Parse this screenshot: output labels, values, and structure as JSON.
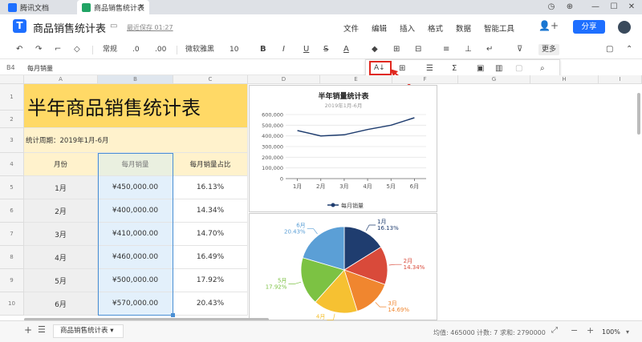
{
  "tabs": [
    {
      "label": "腾讯文档",
      "icon": "tencent-docs-icon"
    },
    {
      "label": "商品销售统计表",
      "icon": "sheet-icon"
    }
  ],
  "header": {
    "title": "商品销售统计表",
    "save_status": "最近保存 01:27",
    "menus": [
      "文件",
      "编辑",
      "插入",
      "格式",
      "数据",
      "智能工具"
    ],
    "share_label": "分享"
  },
  "toolbar": {
    "number_format": "常规",
    "decimal_decrease": ".0",
    "decimal_increase": ".00",
    "font": "微软雅黑",
    "font_size": "10",
    "bold": "B",
    "italic": "I",
    "underline": "U",
    "strike": "S",
    "text_color": "A",
    "more_label": "更多"
  },
  "formula_bar": {
    "cell_ref": "B4",
    "content": "每月销量"
  },
  "columns": [
    "A",
    "B",
    "C",
    "D",
    "E",
    "F",
    "G",
    "H",
    "I"
  ],
  "rows": [
    "1",
    "2",
    "3",
    "4",
    "5",
    "6",
    "7",
    "8",
    "9",
    "10"
  ],
  "sheet": {
    "title": "半年商品销售统计表",
    "period": "统计周期：2019年1月-6月",
    "headers": [
      "月份",
      "每月销量",
      "每月销量占比"
    ],
    "data": [
      [
        "1月",
        "¥450,000.00",
        "16.13%"
      ],
      [
        "2月",
        "¥400,000.00",
        "14.34%"
      ],
      [
        "3月",
        "¥410,000.00",
        "14.70%"
      ],
      [
        "4月",
        "¥460,000.00",
        "16.49%"
      ],
      [
        "5月",
        "¥500,000.00",
        "17.92%"
      ],
      [
        "6月",
        "¥570,000.00",
        "20.43%"
      ]
    ]
  },
  "chart_data": [
    {
      "type": "line",
      "title": "半年销量统计表",
      "subtitle": "2019年1月-6月",
      "categories": [
        "1月",
        "2月",
        "3月",
        "4月",
        "5月",
        "6月"
      ],
      "series": [
        {
          "name": "每月销量",
          "values": [
            450000,
            400000,
            410000,
            460000,
            500000,
            570000
          ]
        }
      ],
      "yticks": [
        "0",
        "100,000",
        "200,000",
        "300,000",
        "400,000",
        "500,000",
        "600,000"
      ],
      "ylim": [
        0,
        600000
      ],
      "grid": true,
      "legend": "bottom",
      "color": "#1f3d6f"
    },
    {
      "type": "pie",
      "labels": [
        "1月",
        "2月",
        "3月",
        "4月",
        "5月",
        "6月"
      ],
      "values": [
        16.13,
        14.34,
        14.7,
        16.49,
        17.92,
        20.43
      ],
      "percent_labels": [
        "16.13%",
        "14.34%",
        "14.69%",
        "16.49%",
        "17.92%",
        "20.43%"
      ],
      "colors": [
        "#1f3d6f",
        "#d94a3a",
        "#f0862f",
        "#f6c132",
        "#7cc243",
        "#5b9fd6"
      ]
    }
  ],
  "status": {
    "sheet_tab": "商品销售统计表",
    "average": "均值: 465000",
    "count": "计数: 7",
    "sum": "求和: 2790000",
    "zoom": "100%"
  },
  "colors": {
    "accent": "#1e6fff",
    "title_fill": "#ffd966",
    "header_fill": "#fff2cc",
    "selected": "#e3f0fb",
    "highlight": "#e0281f"
  }
}
